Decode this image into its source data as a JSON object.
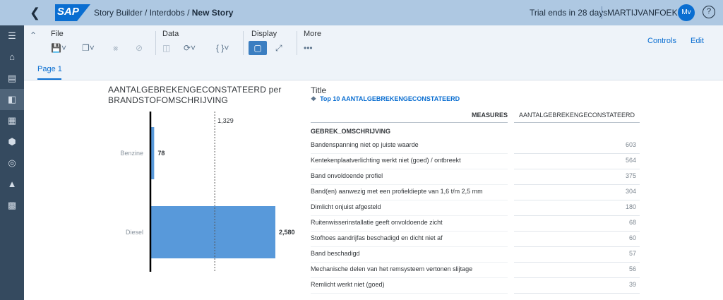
{
  "shell": {
    "logo": "SAP",
    "breadcrumb_prefix": "Story Builder / Interdobs / ",
    "breadcrumb_current": "New Story",
    "trial": "Trial ends in 28 days",
    "user": "MARTIJVANFOEKEN",
    "avatar": "Mv"
  },
  "toolbar": {
    "file_label": "File",
    "data_label": "Data",
    "display_label": "Display",
    "more_label": "More",
    "controls_label": "Controls",
    "edit_label": "Edit"
  },
  "tabs": [
    {
      "label": "Page 1"
    }
  ],
  "chart": {
    "title": "AANTALGEBREKENGECONSTATEERD per BRANDSTOFOMSCHRIJVING",
    "reference_label": "1,329"
  },
  "chart_data": {
    "type": "bar",
    "orientation": "horizontal",
    "title": "AANTALGEBREKENGECONSTATEERD per BRANDSTOFOMSCHRIJVING",
    "categories": [
      "Benzine",
      "Diesel"
    ],
    "values": [
      78,
      2580
    ],
    "value_labels": [
      "78",
      "2,580"
    ],
    "reference_line": 1329,
    "color": "#5899da"
  },
  "table": {
    "title": "Title",
    "subtitle": "Top 10 AANTALGEBREKENGECONSTATEERD",
    "measures_header": "MEASURES",
    "measure_column": "AANTALGEBREKENGECONSTATEERD",
    "dimension_header": "GEBREK_OMSCHRIJVING",
    "rows": [
      {
        "label": "Bandenspanning niet op juiste waarde",
        "value": "603"
      },
      {
        "label": "Kentekenplaatverlichting werkt niet (goed) / ontbreekt",
        "value": "564"
      },
      {
        "label": "Band onvoldoende profiel",
        "value": "375"
      },
      {
        "label": "Band(en) aanwezig met een profieldiepte van 1,6 t/m 2,5 mm",
        "value": "304"
      },
      {
        "label": "Dimlicht onjuist afgesteld",
        "value": "180"
      },
      {
        "label": "Ruitenwisserinstallatie geeft onvoldoende zicht",
        "value": "68"
      },
      {
        "label": "Stofhoes aandrijfas beschadigd en dicht niet af",
        "value": "60"
      },
      {
        "label": "Band beschadigd",
        "value": "57"
      },
      {
        "label": "Mechanische delen van het remsysteem vertonen slijtage",
        "value": "56"
      },
      {
        "label": "Remlicht werkt niet (goed)",
        "value": "39"
      }
    ]
  }
}
